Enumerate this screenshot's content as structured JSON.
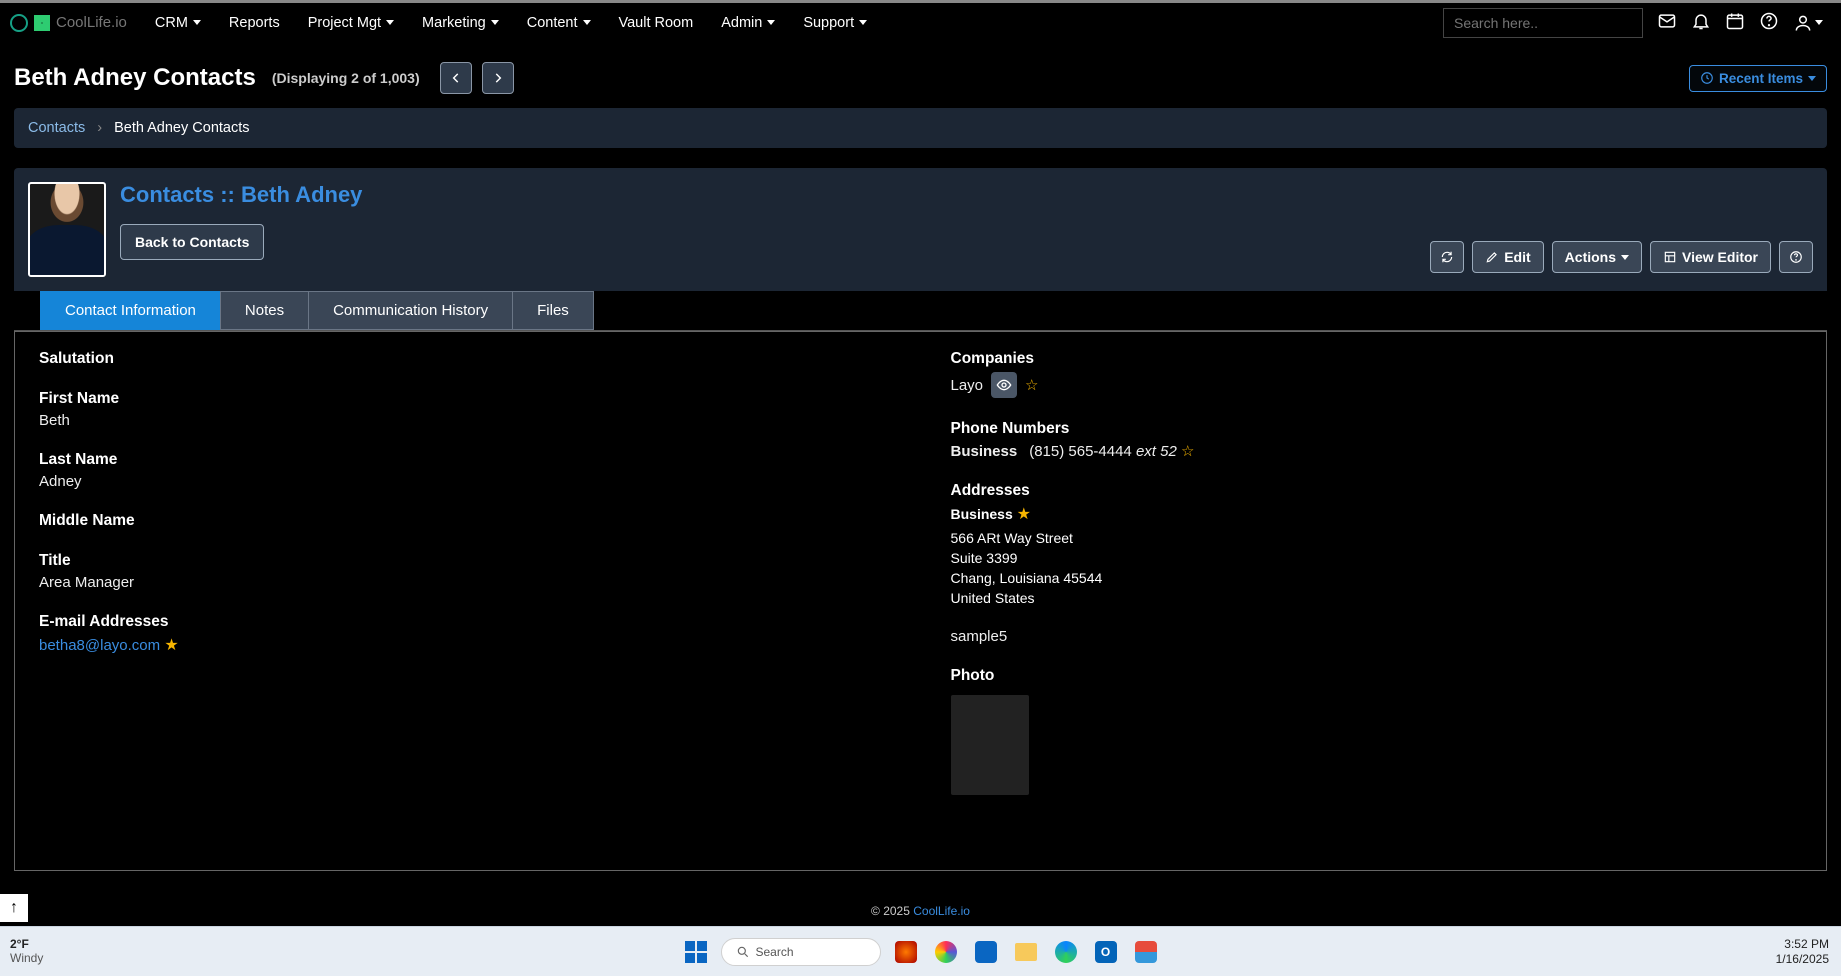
{
  "brand": "CoolLife.io",
  "nav": {
    "crm": "CRM",
    "reports": "Reports",
    "project_mgt": "Project Mgt",
    "marketing": "Marketing",
    "content": "Content",
    "vault_room": "Vault Room",
    "admin": "Admin",
    "support": "Support"
  },
  "search_placeholder": "Search here..",
  "page_title": "Beth Adney Contacts",
  "display_count_text": "(Displaying 2 of 1,003)",
  "recent_items_label": "Recent Items",
  "breadcrumb": {
    "root": "Contacts",
    "current": "Beth Adney Contacts"
  },
  "record": {
    "title": "Contacts :: Beth Adney",
    "back_button": "Back to Contacts",
    "actions": {
      "edit": "Edit",
      "actions_menu": "Actions",
      "view_editor": "View Editor"
    }
  },
  "tabs": {
    "contact_info": "Contact Information",
    "notes": "Notes",
    "comm_history": "Communication History",
    "files": "Files"
  },
  "fields": {
    "salutation_label": "Salutation",
    "salutation_value": "",
    "first_name_label": "First Name",
    "first_name_value": "Beth",
    "last_name_label": "Last Name",
    "last_name_value": "Adney",
    "middle_name_label": "Middle Name",
    "middle_name_value": "",
    "title_label": "Title",
    "title_value": "Area Manager",
    "email_label": "E-mail Addresses",
    "email_value": "betha8@layo.com",
    "companies_label": "Companies",
    "company_name": "Layo",
    "phone_label": "Phone Numbers",
    "phone_type": "Business",
    "phone_number": "(815) 565-4444",
    "phone_ext_label": "ext",
    "phone_ext": "52",
    "addresses_label": "Addresses",
    "address_type": "Business",
    "address_line1": "566 ARt Way Street",
    "address_line2": "Suite 3399",
    "address_city_line": "Chang, Louisiana 45544",
    "address_country": "United States",
    "sample_field": "sample5",
    "photo_label": "Photo"
  },
  "footer": {
    "prefix": "© 2025 ",
    "link": "CoolLife.io"
  },
  "taskbar": {
    "temp": "2°F",
    "cond": "Windy",
    "search": "Search",
    "time": "3:52 PM",
    "date": "1/16/2025"
  }
}
